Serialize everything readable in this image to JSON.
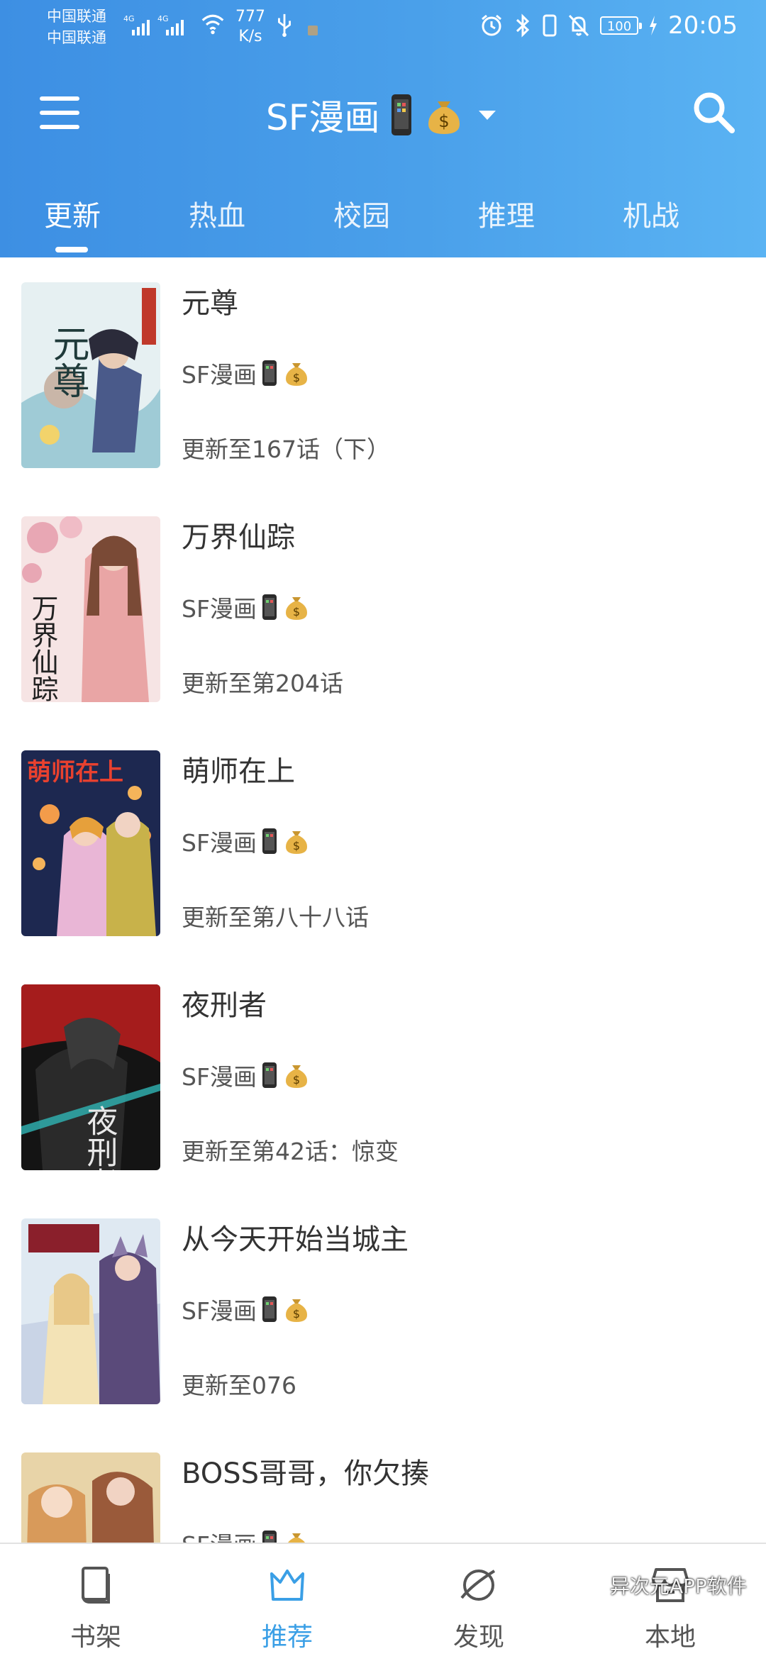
{
  "status": {
    "carrier_1": "中国联通",
    "carrier_2": "中国联通",
    "net_type_1": "4G",
    "net_type_2": "4G",
    "speed_value": "777",
    "speed_unit": "K/s",
    "battery": "100",
    "time": "20:05"
  },
  "app": {
    "title": "SF漫画",
    "icons": [
      "menu-icon",
      "phone-emoji-icon",
      "money-bag-emoji-icon",
      "dropdown-arrow-icon",
      "search-icon"
    ]
  },
  "tabs": [
    {
      "label": "更新",
      "active": true
    },
    {
      "label": "热血",
      "active": false
    },
    {
      "label": "校园",
      "active": false
    },
    {
      "label": "推理",
      "active": false
    },
    {
      "label": "机战",
      "active": false
    }
  ],
  "comics": [
    {
      "title": "元尊",
      "source": "SF漫画",
      "update": "更新至167话（下）",
      "cover_text": "元尊"
    },
    {
      "title": "万界仙踪",
      "source": "SF漫画",
      "update": "更新至第204话",
      "cover_text": "万界仙踪"
    },
    {
      "title": "萌师在上",
      "source": "SF漫画",
      "update": "更新至第八十八话",
      "cover_text": "萌师在上"
    },
    {
      "title": "夜刑者",
      "source": "SF漫画",
      "update": "更新至第42话：惊变",
      "cover_text": "夜刑者"
    },
    {
      "title": "从今天开始当城主",
      "source": "SF漫画",
      "update": "更新至076",
      "cover_text": ""
    },
    {
      "title": "BOSS哥哥，你欠揍",
      "source": "SF漫画",
      "update": "",
      "cover_text": ""
    }
  ],
  "bottom_nav": [
    {
      "label": "书架",
      "icon": "book-icon",
      "active": false
    },
    {
      "label": "推荐",
      "icon": "crown-icon",
      "active": true
    },
    {
      "label": "发现",
      "icon": "planet-icon",
      "active": false
    },
    {
      "label": "本地",
      "icon": "store-icon",
      "active": false
    }
  ],
  "watermark": "异次元APP软件",
  "colors": {
    "header_start": "#3d8fe3",
    "header_end": "#5ab3f3",
    "active_nav": "#3a9fe6"
  }
}
